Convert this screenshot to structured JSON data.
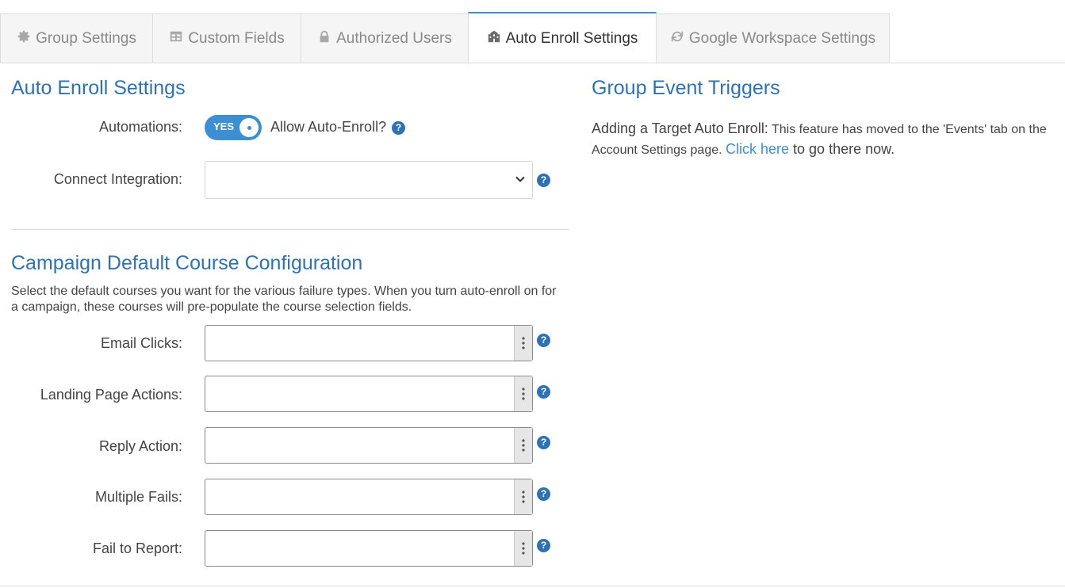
{
  "tabs": [
    {
      "label": "Group Settings",
      "icon": "gear-icon"
    },
    {
      "label": "Custom Fields",
      "icon": "table-icon"
    },
    {
      "label": "Authorized Users",
      "icon": "lock-icon"
    },
    {
      "label": "Auto Enroll Settings",
      "icon": "school-icon",
      "active": true
    },
    {
      "label": "Google Workspace Settings",
      "icon": "refresh-icon"
    }
  ],
  "auto_enroll": {
    "title": "Auto Enroll Settings",
    "automations_label": "Automations:",
    "toggle_text": "YES",
    "allow_label": "Allow Auto-Enroll?",
    "connect_label": "Connect Integration:",
    "connect_value": ""
  },
  "campaign": {
    "title": "Campaign Default Course Configuration",
    "description": "Select the default courses you want for the various failure types. When you turn auto-enroll on for a campaign, these courses will pre-populate the course selection fields.",
    "fields": [
      {
        "label": "Email Clicks:",
        "value": ""
      },
      {
        "label": "Landing Page Actions:",
        "value": ""
      },
      {
        "label": "Reply Action:",
        "value": ""
      },
      {
        "label": "Multiple Fails:",
        "value": ""
      },
      {
        "label": "Fail to Report:",
        "value": ""
      }
    ]
  },
  "triggers": {
    "title": "Group Event Triggers",
    "lead": "Adding a Target Auto Enroll:",
    "text1": " This feature has moved to the 'Events' tab on the Account Settings page. ",
    "link": "Click here",
    "text2": " to go there now."
  },
  "help_glyph": "?",
  "colors": {
    "accent": "#2d72b4",
    "toggle": "#3b8fd2",
    "link": "#3b8fd2"
  }
}
